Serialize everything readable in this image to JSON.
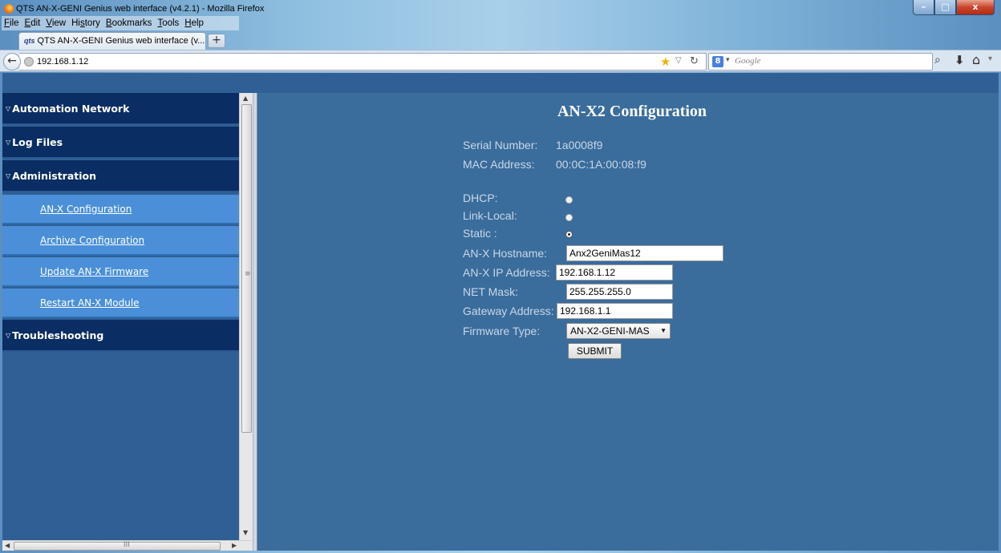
{
  "window": {
    "title": "QTS AN-X-GENI Genius web interface (v4.2.1) - Mozilla Firefox",
    "minimize": "–",
    "maximize": "□",
    "close": "x"
  },
  "menubar": {
    "items": [
      {
        "u": "F",
        "rest": "ile"
      },
      {
        "u": "E",
        "rest": "dit"
      },
      {
        "u": "V",
        "rest": "iew"
      },
      {
        "pre": "Hi",
        "u": "s",
        "rest": "tory"
      },
      {
        "u": "B",
        "rest": "ookmarks"
      },
      {
        "u": "T",
        "rest": "ools"
      },
      {
        "u": "H",
        "rest": "elp"
      }
    ]
  },
  "tab": {
    "icon_text": "qts",
    "label": "QTS AN-X-GENI Genius web interface (v...",
    "newtab": "+"
  },
  "navbar": {
    "url": "192.168.1.12",
    "search_engine": "8",
    "search_placeholder": "Google"
  },
  "sidebar": {
    "headings": [
      {
        "label": "Automation Network"
      },
      {
        "label": "Log Files"
      },
      {
        "label": "Administration"
      },
      {
        "label": "Troubleshooting"
      }
    ],
    "admin_items": [
      {
        "label": "AN-X Configuration"
      },
      {
        "label": "Archive Configuration"
      },
      {
        "label": "Update AN-X Firmware"
      },
      {
        "label": "Restart AN-X Module"
      }
    ],
    "scroll_hgrip": "III"
  },
  "main": {
    "heading": "AN-X2 Configuration",
    "serial_label": "Serial Number:",
    "serial_value": "1a0008f9",
    "mac_label": "MAC Address:",
    "mac_value": "00:0C:1A:00:08:f9",
    "dhcp_label": "DHCP:",
    "linklocal_label": "Link-Local:",
    "static_label": "Static :",
    "ip_mode_selected": "Static",
    "hostname_label": "AN-X Hostname:",
    "hostname_value": "Anx2GeniMas12",
    "ip_label": "AN-X IP Address:",
    "ip_value": "192.168.1.12",
    "netmask_label": "NET Mask:",
    "netmask_value": "255.255.255.0",
    "gateway_label": "Gateway Address:",
    "gateway_value": "192.168.1.1",
    "fwtype_label": "Firmware Type:",
    "fwtype_value": "AN-X2-GENI-MAS",
    "submit_label": "SUBMIT"
  },
  "colors": {
    "sidebar_heading": "#0a2d63",
    "sidebar_item": "#4a8fd8",
    "main_bg": "#3a6c9c",
    "label_text": "#c9d8e8"
  }
}
